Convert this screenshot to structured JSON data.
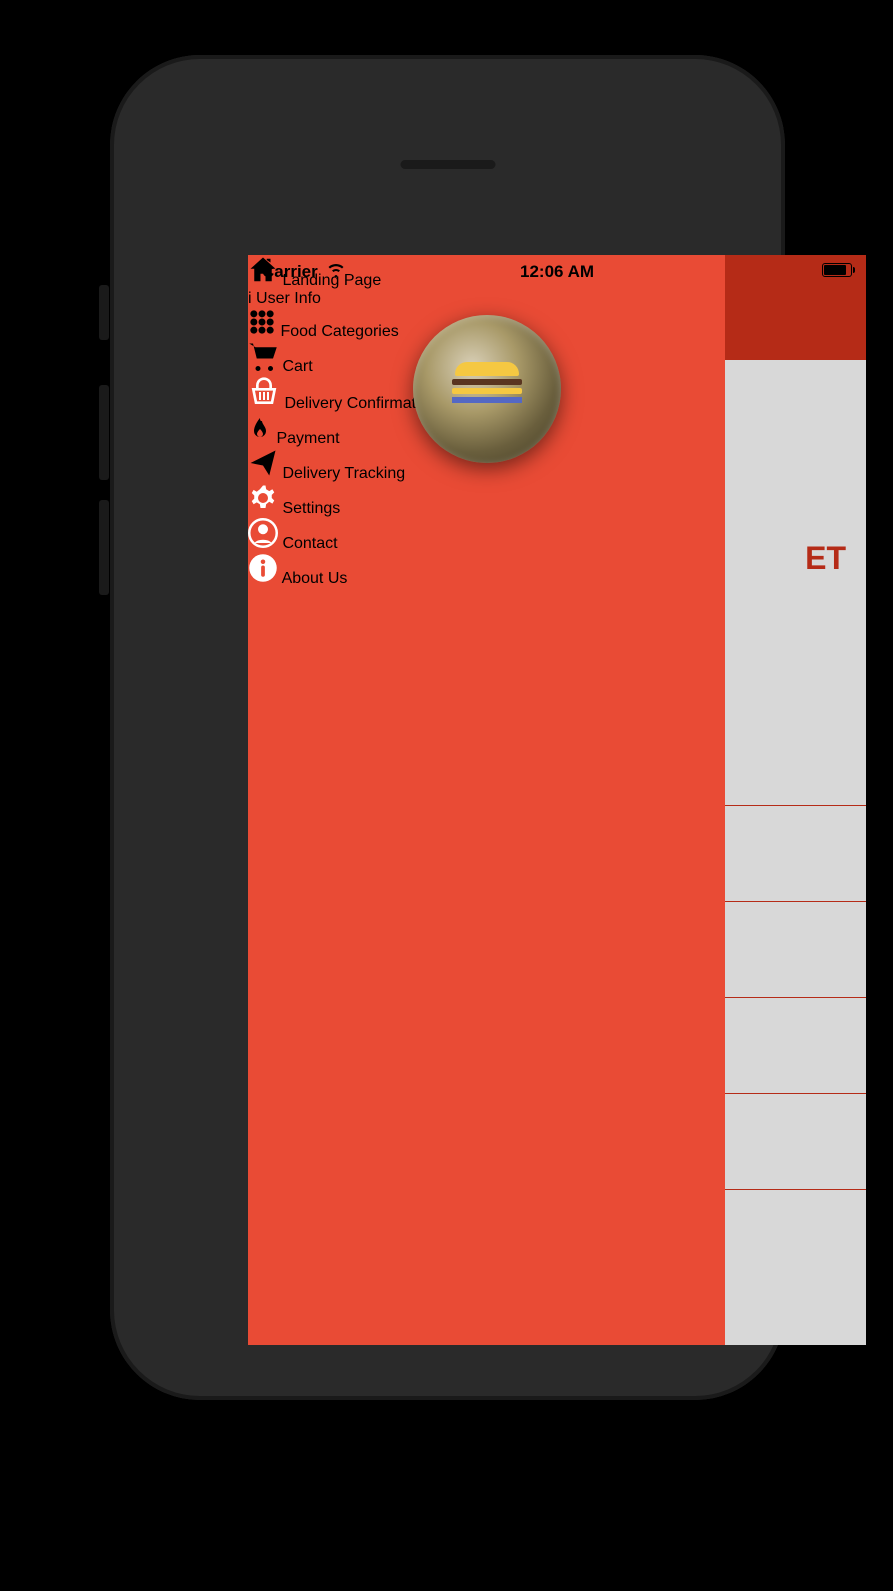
{
  "statusBar": {
    "carrier": "Carrier",
    "time": "12:06 AM"
  },
  "background": {
    "headingPartial": "ET"
  },
  "sidebar": {
    "items": [
      {
        "label": "Landing Page",
        "icon": "home-icon"
      },
      {
        "label": "User Info",
        "icon": "info-letter-icon"
      },
      {
        "label": "Food Categories",
        "icon": "grid-icon"
      },
      {
        "label": "Cart",
        "icon": "cart-icon"
      },
      {
        "label": "Delivery Confirmation",
        "icon": "basket-icon"
      },
      {
        "label": "Payment",
        "icon": "flame-icon"
      },
      {
        "label": "Delivery Tracking",
        "icon": "paper-plane-icon"
      },
      {
        "label": "Settings",
        "icon": "gear-icon"
      },
      {
        "label": "Contact",
        "icon": "user-circle-icon"
      },
      {
        "label": "About Us",
        "icon": "info-circle-icon"
      }
    ]
  },
  "device": {
    "label": "iPhone 7 - 11.2"
  },
  "colors": {
    "sidebarBg": "#e94b35",
    "headerBg": "#b52b17"
  }
}
